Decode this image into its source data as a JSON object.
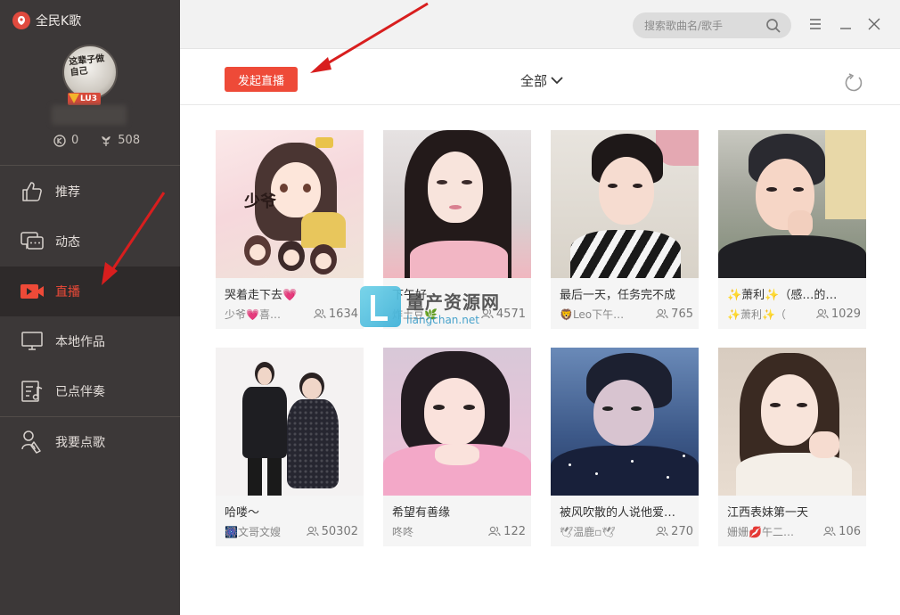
{
  "app": {
    "title": "全民K歌"
  },
  "profile": {
    "avatar_text": "这辈子做自己",
    "level": "LU3",
    "coins": "0",
    "flowers": "508"
  },
  "sidebar": {
    "items": [
      {
        "label": "推荐",
        "icon": "thumbs-up-icon"
      },
      {
        "label": "动态",
        "icon": "chat-icon"
      },
      {
        "label": "直播",
        "icon": "live-video-icon"
      },
      {
        "label": "本地作品",
        "icon": "monitor-icon"
      },
      {
        "label": "已点伴奏",
        "icon": "music-list-icon"
      },
      {
        "label": "我要点歌",
        "icon": "pick-song-icon"
      }
    ]
  },
  "search": {
    "placeholder": "搜索歌曲名/歌手"
  },
  "toolbar": {
    "live_button": "发起直播",
    "filter_label": "全部"
  },
  "cards": [
    {
      "title": "哭着走下去💗",
      "author": "少爷💗喜…",
      "viewers": "1634"
    },
    {
      "title": "下午好",
      "author": "炸土豆🌿",
      "viewers": "4571"
    },
    {
      "title": "最后一天，任务完不成",
      "author": "🦁Leo下午…",
      "viewers": "765"
    },
    {
      "title": "✨萧利✨（感…的…",
      "author": "✨萧利✨（",
      "viewers": "1029"
    },
    {
      "title": "哈喽～",
      "author": "🎆文哥文嫂",
      "viewers": "50302"
    },
    {
      "title": "希望有善缘",
      "author": "咚咚",
      "viewers": "122"
    },
    {
      "title": "被风吹散的人说他爱…",
      "author": "🕊温鹿▫🕊",
      "viewers": "270"
    },
    {
      "title": "江西表妹第一天",
      "author": "姗姗💋午二…",
      "viewers": "106"
    }
  ],
  "watermark": {
    "cn": "量产资源网",
    "en": "liangchan.net"
  },
  "colors": {
    "accent": "#ee4a38",
    "sidebar_bg": "#3c3838"
  }
}
